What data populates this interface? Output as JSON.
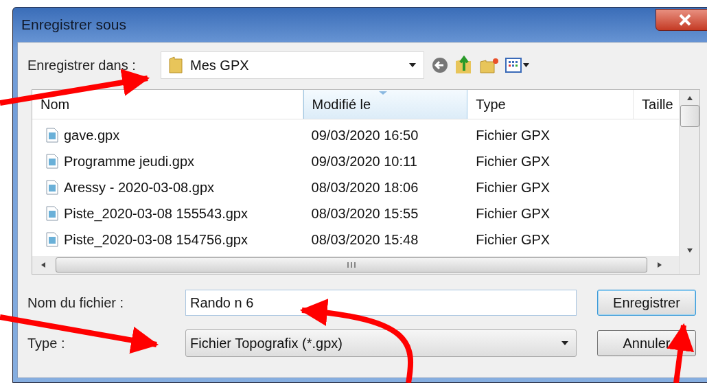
{
  "window": {
    "title": "Enregistrer sous"
  },
  "save_in": {
    "label": "Enregistrer dans :",
    "value": "Mes GPX"
  },
  "file_list": {
    "columns": [
      {
        "label": "Nom",
        "sorted": false
      },
      {
        "label": "Modifié le",
        "sorted": true
      },
      {
        "label": "Type",
        "sorted": false
      },
      {
        "label": "Taille",
        "sorted": false
      }
    ],
    "rows": [
      {
        "name": "gave.gpx",
        "modified": "09/03/2020 16:50",
        "type": "Fichier GPX"
      },
      {
        "name": "Programme jeudi.gpx",
        "modified": "09/03/2020 10:11",
        "type": "Fichier GPX"
      },
      {
        "name": "Aressy - 2020-03-08.gpx",
        "modified": "08/03/2020 18:06",
        "type": "Fichier GPX"
      },
      {
        "name": "Piste_2020-03-08 155543.gpx",
        "modified": "08/03/2020 15:55",
        "type": "Fichier GPX"
      },
      {
        "name": "Piste_2020-03-08 154756.gpx",
        "modified": "08/03/2020 15:48",
        "type": "Fichier GPX"
      }
    ]
  },
  "file_name": {
    "label": "Nom du fichier :",
    "value": "Rando n 6"
  },
  "file_type": {
    "label": "Type :",
    "value": "Fichier Topografix (*.gpx)"
  },
  "buttons": [
    {
      "label": "Enregistrer",
      "default": true
    },
    {
      "label": "Annuler",
      "default": false
    }
  ]
}
